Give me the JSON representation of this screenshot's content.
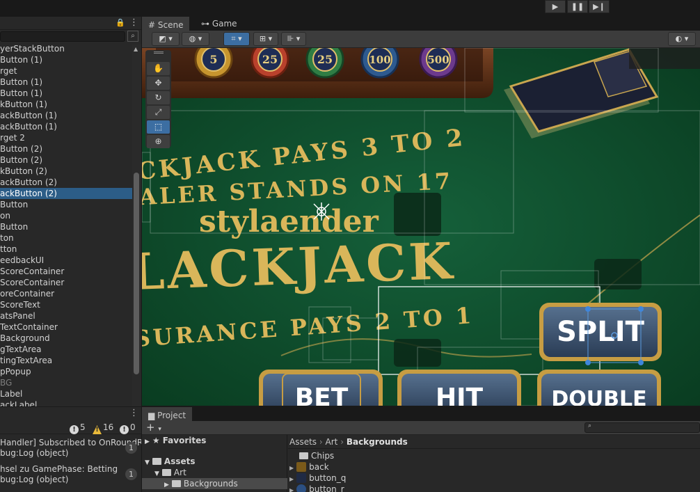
{
  "toolbar": {
    "play": "▶",
    "pause": "❚❚",
    "step": "▶❙"
  },
  "hierarchy": {
    "menu_icon": "⋮",
    "lock_icon": "🔒",
    "items": [
      {
        "label": "yerStackButton",
        "state": ""
      },
      {
        "label": "Button (1)",
        "state": ""
      },
      {
        "label": "rget",
        "state": ""
      },
      {
        "label": "Button (1)",
        "state": ""
      },
      {
        "label": "Button (1)",
        "state": ""
      },
      {
        "label": "kButton (1)",
        "state": ""
      },
      {
        "label": "ackButton (1)",
        "state": ""
      },
      {
        "label": "ackButton (1)",
        "state": ""
      },
      {
        "label": "rget 2",
        "state": ""
      },
      {
        "label": "Button (2)",
        "state": ""
      },
      {
        "label": "Button (2)",
        "state": ""
      },
      {
        "label": "kButton (2)",
        "state": ""
      },
      {
        "label": "ackButton (2)",
        "state": ""
      },
      {
        "label": "ackButton (2)",
        "state": "sel"
      },
      {
        "label": "Button",
        "state": ""
      },
      {
        "label": "on",
        "state": ""
      },
      {
        "label": "Button",
        "state": ""
      },
      {
        "label": "ton",
        "state": ""
      },
      {
        "label": "tton",
        "state": ""
      },
      {
        "label": "eedbackUI",
        "state": ""
      },
      {
        "label": "ScoreContainer",
        "state": ""
      },
      {
        "label": "ScoreContainer",
        "state": ""
      },
      {
        "label": "oreContainer",
        "state": ""
      },
      {
        "label": "ScoreText",
        "state": ""
      },
      {
        "label": "atsPanel",
        "state": ""
      },
      {
        "label": "TextContainer",
        "state": ""
      },
      {
        "label": "Background",
        "state": ""
      },
      {
        "label": "gTextArea",
        "state": ""
      },
      {
        "label": "tingTextArea",
        "state": ""
      },
      {
        "label": "pPopup",
        "state": ""
      },
      {
        "label": "BG",
        "state": "dim"
      },
      {
        "label": "Label",
        "state": ""
      },
      {
        "label": "ackLabel",
        "state": ""
      }
    ]
  },
  "console": {
    "menu_icon": "⋮",
    "info_count": "5",
    "warn_count": "16",
    "error_count": "0",
    "entries": [
      {
        "line1": "Handler] Subscribed to OnRoundRese",
        "line2": "bug:Log (object)",
        "count": "1"
      },
      {
        "line1": "hsel zu GamePhase: Betting",
        "line2": "bug:Log (object)",
        "count": "1"
      }
    ]
  },
  "scene_tabs": {
    "scene": "Scene",
    "game": "Game"
  },
  "scene": {
    "chips": [
      "5",
      "25",
      "25",
      "100",
      "500"
    ],
    "felt_line1": "CKJACK PAYS 3 TO 2",
    "felt_line2": "ALER STANDS ON 17",
    "brand": "stylaender",
    "title": "LACKJACK",
    "felt_line3": "SURANCE PAYS 2 TO 1",
    "buttons": {
      "split": "SPLIT",
      "bet": "BET",
      "hit": "HIT",
      "double": "DOUBLE"
    }
  },
  "project": {
    "tab": "Project",
    "add_label": "+",
    "tree": {
      "favorites": "Favorites",
      "assets": "Assets",
      "art": "Art",
      "backgrounds": "Backgrounds"
    },
    "breadcrumb": [
      "Assets",
      "Art",
      "Backgrounds"
    ],
    "files": [
      "Chips",
      "back",
      "button_q",
      "button_r"
    ]
  },
  "colors": {
    "selection": "#2c5d87",
    "felt": "#0e4526",
    "gold": "#d9b65a",
    "button_blue": "#3d5a7a"
  }
}
